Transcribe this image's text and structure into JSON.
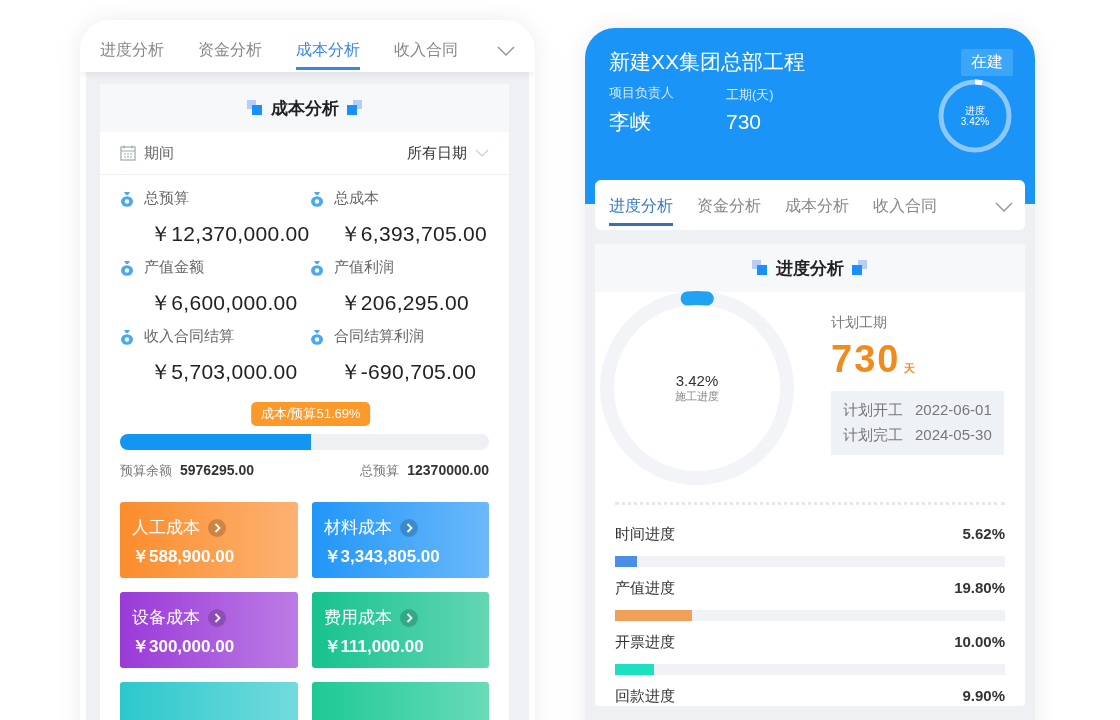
{
  "cost_screen": {
    "tabs": [
      {
        "label": "进度分析",
        "selected": false
      },
      {
        "label": "资金分析",
        "selected": false
      },
      {
        "label": "成本分析",
        "selected": true
      },
      {
        "label": "收入合同",
        "selected": false
      }
    ],
    "section_title": "成本分析",
    "period": {
      "label": "期间",
      "value": "所有日期"
    },
    "stats": [
      {
        "label": "总预算",
        "value": "￥12,370,000.00"
      },
      {
        "label": "总成本",
        "value": "￥6,393,705.00"
      },
      {
        "label": "产值金额",
        "value": "￥6,600,000.00"
      },
      {
        "label": "产值利润",
        "value": "￥206,295.00"
      },
      {
        "label": "收入合同结算",
        "value": "￥5,703,000.00"
      },
      {
        "label": "合同结算利润",
        "value": "￥-690,705.00"
      }
    ],
    "budget_bar": {
      "tooltip": "成本/预算51.69%",
      "level": 0.5169,
      "remaining_label": "预算余额",
      "remaining_value": "5976295.00",
      "total_label": "总预算",
      "total_value": "12370000.00"
    },
    "cost_cards": [
      {
        "title": "人工成本",
        "value": "￥588,900.00",
        "color": "#fb8c2c"
      },
      {
        "title": "材料成本",
        "value": "￥3,343,805.00",
        "color": "#2196f8"
      },
      {
        "title": "设备成本",
        "value": "￥300,000.00",
        "color": "#9a3ad8"
      },
      {
        "title": "费用成本",
        "value": "￥111,000.00",
        "color": "#16c28e"
      },
      {
        "color": "#2cc8cc"
      },
      {
        "color": "#1ec996"
      }
    ]
  },
  "progress_screen": {
    "project_title": "新建XX集团总部工程",
    "status": "在建",
    "fields": [
      {
        "label": "项目负责人",
        "value": "李峡"
      },
      {
        "label": "工期(天)",
        "value": "730"
      }
    ],
    "header_ring": {
      "label": "进度",
      "value": "3.42%",
      "level": 0.0342
    },
    "tabs": [
      {
        "label": "进度分析",
        "selected": true
      },
      {
        "label": "资金分析",
        "selected": false
      },
      {
        "label": "成本分析",
        "selected": false
      },
      {
        "label": "收入合同",
        "selected": false
      }
    ],
    "section_title": "进度分析",
    "ring": {
      "value": "3.42%",
      "label": "施工进度",
      "level": 0.0342
    },
    "planned": {
      "label": "计划工期",
      "days": "730",
      "unit": "天",
      "dates": [
        {
          "label": "计划开工",
          "value": "2022-06-01"
        },
        {
          "label": "计划完工",
          "value": "2024-05-30"
        }
      ]
    },
    "bars": [
      {
        "label": "时间进度",
        "value": "5.62%",
        "level": 0.0562,
        "color": "#4a8ee8"
      },
      {
        "label": "产值进度",
        "value": "19.80%",
        "level": 0.198,
        "color": "#f0a058"
      },
      {
        "label": "开票进度",
        "value": "10.00%",
        "level": 0.1,
        "color": "#1de0c0"
      },
      {
        "label": "回款进度",
        "value": "9.90%"
      }
    ]
  }
}
